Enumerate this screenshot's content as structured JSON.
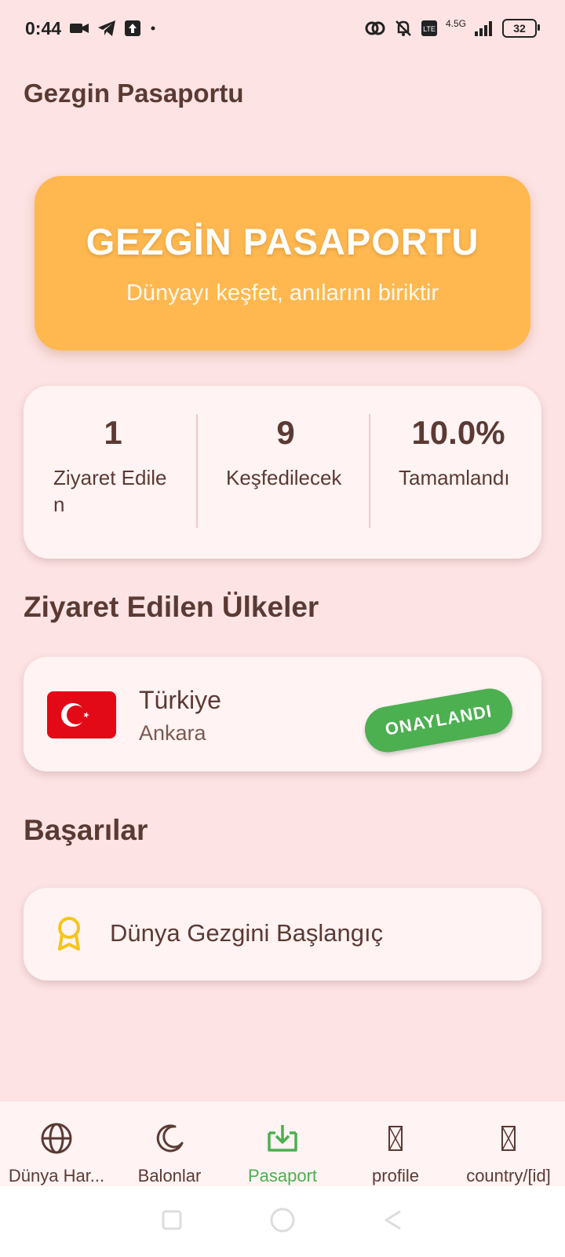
{
  "status_bar": {
    "time": "0:44",
    "network": "4.5G",
    "battery": "32"
  },
  "header": {
    "title": "Gezgin Pasaportu"
  },
  "hero": {
    "title": "GEZGİN PASAPORTU",
    "subtitle": "Dünyayı keşfet, anılarını biriktir"
  },
  "stats": [
    {
      "value": "1",
      "label": "Ziyaret Edilen"
    },
    {
      "value": "9",
      "label": "Keşfedilecek"
    },
    {
      "value": "10.0%",
      "label": "Tamamlandı"
    }
  ],
  "visited_section": {
    "title": "Ziyaret Edilen Ülkeler",
    "countries": [
      {
        "name": "Türkiye",
        "capital": "Ankara",
        "status": "ONAYLANDI",
        "flag": "turkey-flag"
      }
    ]
  },
  "achievements_section": {
    "title": "Başarılar",
    "items": [
      {
        "label": "Dünya Gezgini Başlangıç",
        "icon": "award-icon"
      }
    ]
  },
  "bottom_nav": {
    "items": [
      {
        "label": "Dünya Har...",
        "icon": "globe-icon",
        "active": false
      },
      {
        "label": "Balonlar",
        "icon": "moon-icon",
        "active": false
      },
      {
        "label": "Pasaport",
        "icon": "download-icon",
        "active": true
      },
      {
        "label": "profile",
        "icon": "missing-glyph-icon",
        "active": false
      },
      {
        "label": "country/[id]",
        "icon": "missing-glyph-icon",
        "active": false
      }
    ]
  },
  "colors": {
    "background": "#fde3e4",
    "accent": "#ffb84f",
    "text": "#5b3a34",
    "success": "#4caf50",
    "award": "#f5c518"
  }
}
